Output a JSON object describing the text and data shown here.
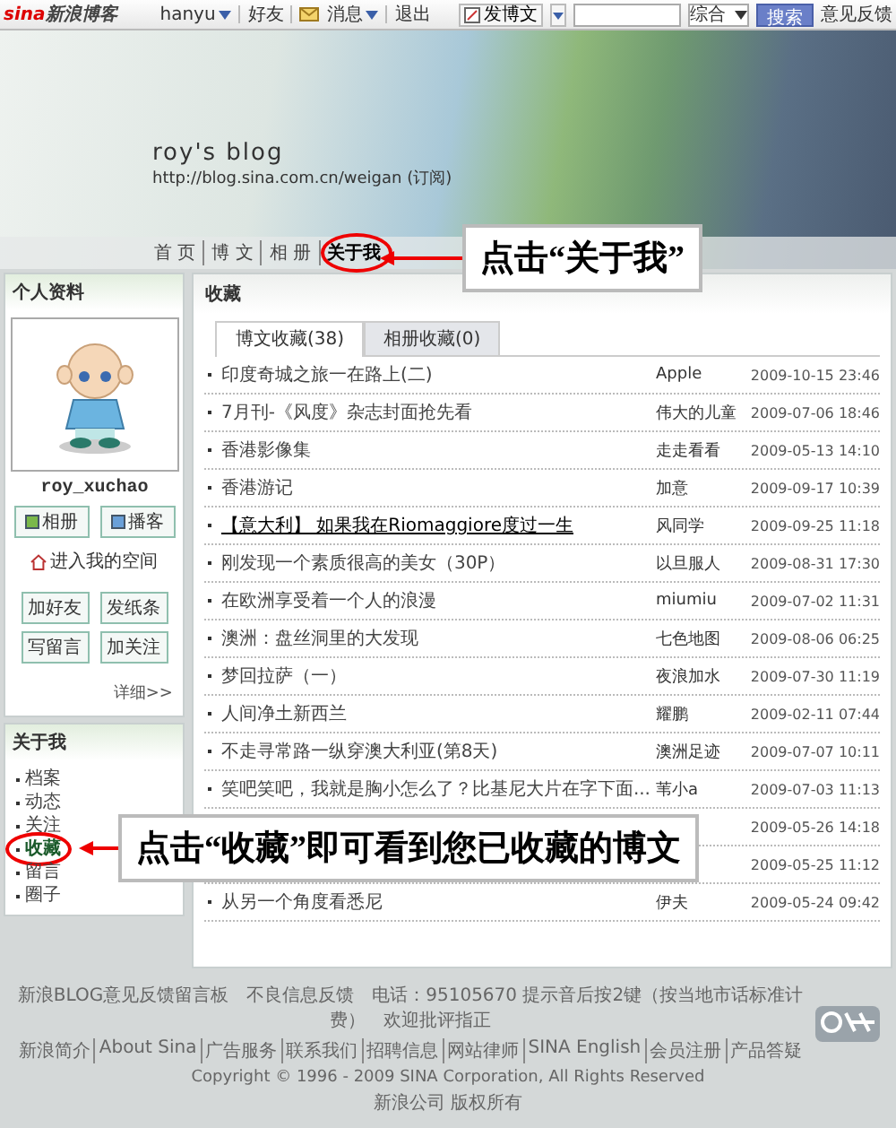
{
  "topbar": {
    "logo_mark": "sina",
    "logo_text": "新浪博客",
    "user": "hanyu",
    "friends": "好友",
    "messages": "消息",
    "logout": "退出",
    "post_button": "发博文",
    "search_scope": "综合",
    "search_button": "搜索",
    "feedback": "意见反馈"
  },
  "banner": {
    "title": "roy's blog",
    "url": "http://blog.sina.com.cn/weigan",
    "subscribe": "(订阅)"
  },
  "nav": [
    {
      "label": "首 页",
      "selected": false
    },
    {
      "label": "博 文",
      "selected": false
    },
    {
      "label": "相 册",
      "selected": false
    },
    {
      "label": "关于我",
      "selected": true
    }
  ],
  "profile": {
    "title": "个人资料",
    "name": "roy_xuchao",
    "media_buttons": [
      "相册",
      "播客"
    ],
    "space_link": "进入我的空间",
    "actions": [
      "加好友",
      "发纸条",
      "写留言",
      "加关注"
    ],
    "more": "详细>>"
  },
  "about": {
    "title": "关于我",
    "items": [
      {
        "label": "档案",
        "selected": false
      },
      {
        "label": "动态",
        "selected": false
      },
      {
        "label": "关注",
        "selected": false
      },
      {
        "label": "收藏",
        "selected": true
      },
      {
        "label": "留言",
        "selected": false
      },
      {
        "label": "圈子",
        "selected": false
      }
    ]
  },
  "favorites": {
    "title": "收藏",
    "tabs": [
      {
        "label": "博文收藏(38)",
        "selected": true
      },
      {
        "label": "相册收藏(0)",
        "selected": false
      }
    ],
    "rows": [
      {
        "title": "印度奇城之旅一在路上(二)",
        "author": "Apple",
        "date": "2009-10-15 23:46",
        "hovered": false
      },
      {
        "title": "7月刊-《风度》杂志封面抢先看",
        "author": "伟大的儿童",
        "date": "2009-07-06 18:46",
        "hovered": false
      },
      {
        "title": "香港影像集",
        "author": "走走看看",
        "date": "2009-05-13 14:10",
        "hovered": false
      },
      {
        "title": "香港游记",
        "author": "加意",
        "date": "2009-09-17 10:39",
        "hovered": false
      },
      {
        "title": "【意大利】 如果我在Riomaggiore度过一生",
        "author": "风同学",
        "date": "2009-09-25 11:18",
        "hovered": true
      },
      {
        "title": "刚发现一个素质很高的美女（30P）",
        "author": "以旦服人",
        "date": "2009-08-31 17:30",
        "hovered": false
      },
      {
        "title": "在欧洲享受着一个人的浪漫",
        "author": "miumiu",
        "date": "2009-07-02 11:31",
        "hovered": false
      },
      {
        "title": "澳洲：盘丝洞里的大发现",
        "author": "七色地图",
        "date": "2009-08-06 06:25",
        "hovered": false
      },
      {
        "title": "梦回拉萨（一）",
        "author": "夜浪加水",
        "date": "2009-07-30 11:19",
        "hovered": false
      },
      {
        "title": "人间净土新西兰",
        "author": "耀鹏",
        "date": "2009-02-11 07:44",
        "hovered": false
      },
      {
        "title": "不走寻常路一纵穿澳大利亚(第8天)",
        "author": "澳洲足迹",
        "date": "2009-07-07 10:11",
        "hovered": false
      },
      {
        "title": "笑吧笑吧，我就是胸小怎么了？比基尼大片在字下面...",
        "author": "苇小a",
        "date": "2009-07-03 11:13",
        "hovered": false
      },
      {
        "date": "2009-05-26 14:18"
      },
      {
        "date": "2009-05-25 11:12"
      },
      {
        "title": "从另一个角度看悉尼",
        "author": "伊夫",
        "date": "2009-05-24 09:42",
        "hovered": false
      }
    ]
  },
  "footer": {
    "line": "新浪BLOG意见反馈留言板　不良信息反馈　电话：95105670 提示音后按2键（按当地市话标准计费）　欢迎批评指正",
    "links": [
      "新浪简介",
      "About Sina",
      "广告服务",
      "联系我们",
      "招聘信息",
      "网站律师",
      "SINA English",
      "会员注册",
      "产品答疑"
    ],
    "copyright": "Copyright © 1996 - 2009 SINA Corporation, All Rights Reserved",
    "rights": "新浪公司 版权所有"
  },
  "annotations": [
    {
      "text": "点击“关于我”"
    },
    {
      "text": "点击“收藏”即可看到您已收藏的博文"
    }
  ]
}
